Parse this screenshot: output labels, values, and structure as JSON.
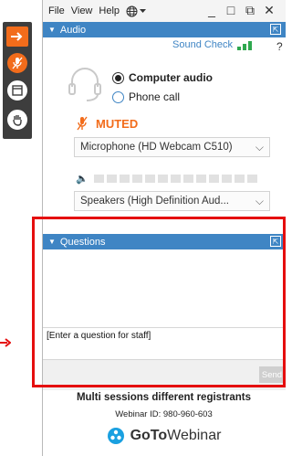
{
  "menu": {
    "file": "File",
    "view": "View",
    "help": "Help"
  },
  "window_controls": {
    "minimize": "_",
    "restore": "□",
    "popout": "⧉",
    "close": "✕"
  },
  "audio": {
    "title": "Audio",
    "sound_check": "Sound Check",
    "help": "?",
    "options": [
      {
        "label": "Computer audio",
        "selected": true
      },
      {
        "label": "Phone call",
        "selected": false
      }
    ],
    "muted": "MUTED",
    "microphone": "Microphone (HD Webcam C510)",
    "speakers": "Speakers (High Definition Aud..."
  },
  "questions": {
    "title": "Questions",
    "placeholder": "[Enter a question for staff]",
    "send": "Send"
  },
  "session": {
    "title": "Multi sessions different registrants",
    "webinar_id": "Webinar ID: 980-960-603"
  },
  "brand": {
    "bold": "GoTo",
    "light": "Webinar"
  },
  "colors": {
    "accent": "#3f85c4",
    "orange": "#f26c1b",
    "highlight": "#e50e0e"
  }
}
